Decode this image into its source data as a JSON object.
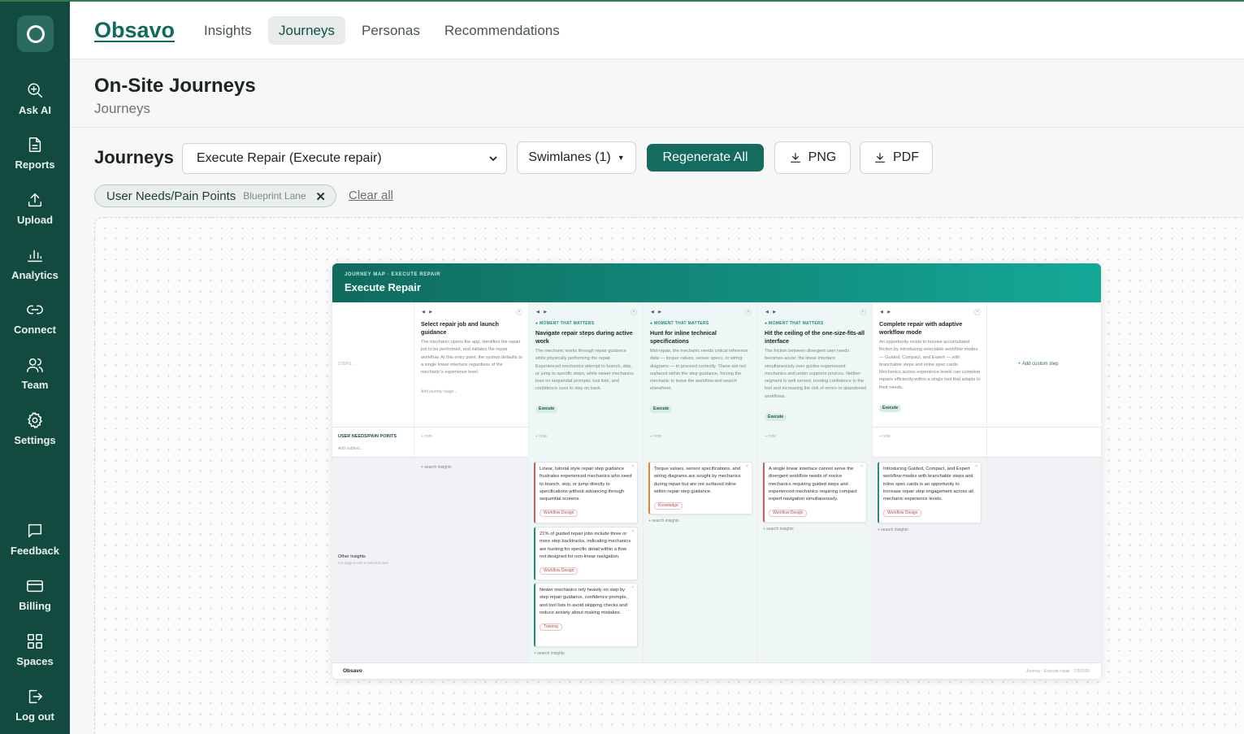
{
  "brand": "Obsavo",
  "sidebar": {
    "items": [
      {
        "label": "Ask AI",
        "icon": "search-plus-icon"
      },
      {
        "label": "Reports",
        "icon": "document-icon"
      },
      {
        "label": "Upload",
        "icon": "upload-icon"
      },
      {
        "label": "Analytics",
        "icon": "bar-chart-icon"
      },
      {
        "label": "Connect",
        "icon": "link-icon"
      },
      {
        "label": "Team",
        "icon": "users-icon"
      },
      {
        "label": "Settings",
        "icon": "gear-icon"
      },
      {
        "label": "Feedback",
        "icon": "message-icon"
      },
      {
        "label": "Billing",
        "icon": "card-icon"
      },
      {
        "label": "Spaces",
        "icon": "grid-icon"
      },
      {
        "label": "Log out",
        "icon": "logout-icon"
      }
    ]
  },
  "nav": {
    "tabs": [
      "Insights",
      "Journeys",
      "Personas",
      "Recommendations"
    ],
    "active": "Journeys"
  },
  "page": {
    "title": "On-Site Journeys",
    "subtitle": "Journeys"
  },
  "toolbar": {
    "label": "Journeys",
    "journey_select": "Execute Repair (Execute repair)",
    "swimlanes": "Swimlanes (1)",
    "regenerate": "Regenerate All",
    "png": "PNG",
    "pdf": "PDF"
  },
  "filters": {
    "chip_name": "User Needs/Pain Points",
    "chip_sub": "Blueprint Lane",
    "clear": "Clear all"
  },
  "journey_map": {
    "kicker": "JOURNEY MAP · EXECUTE REPAIR",
    "title": "Execute Repair",
    "steps_label": "STEPS →",
    "lane_label": "USER NEEDS/PAIN POINTS",
    "lane_sub": "Add subtext...",
    "other_label": "Other insights",
    "other_sub": "not tagged with a selected lane",
    "moment_label": "● MOMENT THAT MATTERS",
    "add_stage": "Add journey stage...",
    "note": "+ note",
    "search": "+ search insights",
    "add_custom": "+ Add custom step",
    "steps": [
      {
        "title": "Select repair job and launch guidance",
        "desc": "The mechanic opens the app, identifies the repair job to be performed, and initiates the repair workflow. At this entry point, the system defaults to a single linear interface regardless of the mechanic's experience level.",
        "phase": "",
        "moment": false
      },
      {
        "title": "Navigate repair steps during active work",
        "desc": "The mechanic works through repair guidance while physically performing the repair. Experienced mechanics attempt to branch, skip, or jump to specific steps, while newer mechanics lean on sequential prompts, tool lists, and confidence cues to stay on track.",
        "phase": "Execute",
        "moment": true
      },
      {
        "title": "Hunt for inline technical specifications",
        "desc": "Mid-repair, the mechanic needs critical reference data — torque values, sensor specs, or wiring diagrams — to proceed correctly. These are not surfaced within the step guidance, forcing the mechanic to leave the workflow and search elsewhere.",
        "phase": "Execute",
        "moment": true
      },
      {
        "title": "Hit the ceiling of the one-size-fits-all interface",
        "desc": "The friction between divergent user needs becomes acute: the linear interface simultaneously over guides experienced mechanics and under supports novices. Neither segment is well served, eroding confidence in the tool and increasing the risk of errors or abandoned workflows.",
        "phase": "Execute",
        "moment": true
      },
      {
        "title": "Complete repair with adaptive workflow mode",
        "desc": "An opportunity exists to resolve accumulated friction by introducing selectable workflow modes — Guided, Compact, and Expert — with branchable steps and inline spec cards. Mechanics across experience levels can complete repairs efficiently within a single tool that adapts to their needs.",
        "phase": "Execute",
        "moment": false
      }
    ],
    "insights": [
      [],
      [
        {
          "text": "Linear, tutorial style repair step guidance frustrates experienced mechanics who need to branch, skip, or jump directly to specifications without advancing through sequential screens.",
          "tag": "Workflow Design",
          "kind": "r"
        },
        {
          "text": "21% of guided repair jobs include three or more step backtracks, indicating mechanics are hunting for specific detail within a flow not designed for non-linear navigation.",
          "tag": "Workflow Design",
          "kind": "g"
        },
        {
          "text": "Newer mechanics rely heavily on step by step repair guidance, confidence prompts, and tool lists to avoid skipping checks and reduce anxiety about making mistakes.",
          "tag": "Training",
          "kind": "g"
        }
      ],
      [
        {
          "text": "Torque values, sensor specifications, and wiring diagrams are sought by mechanics during repair but are not surfaced inline within repair step guidance.",
          "tag": "Knowledge",
          "kind": "k"
        }
      ],
      [
        {
          "text": "A single linear interface cannot serve the divergent workflow needs of novice mechanics requiring guided steps and experienced mechanics requiring compact expert navigation simultaneously.",
          "tag": "Workflow Design",
          "kind": "r"
        }
      ],
      [
        {
          "text": "Introducing Guided, Compact, and Expert workflow modes with branchable steps and inline spec cards is an opportunity to increase repair step engagement across all mechanic experience levels.",
          "tag": "Workflow Design",
          "kind": "g"
        }
      ]
    ],
    "footer_brand": "Obsavo",
    "footer_meta": "Journey · Execute repair · 7/9/2026"
  }
}
